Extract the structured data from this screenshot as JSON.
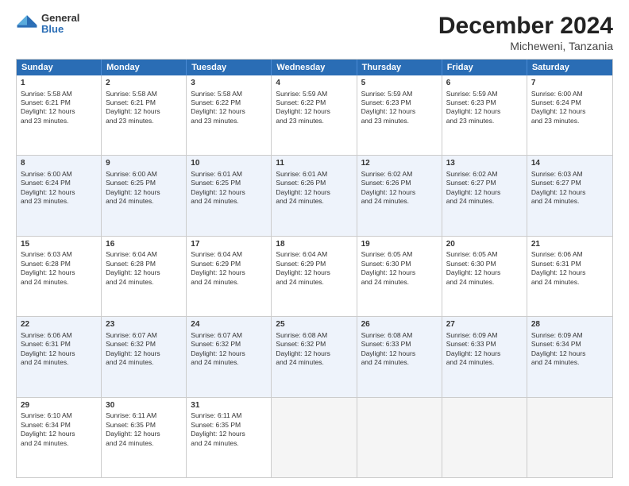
{
  "header": {
    "logo_general": "General",
    "logo_blue": "Blue",
    "month_year": "December 2024",
    "location": "Micheweni, Tanzania"
  },
  "days_of_week": [
    "Sunday",
    "Monday",
    "Tuesday",
    "Wednesday",
    "Thursday",
    "Friday",
    "Saturday"
  ],
  "weeks": [
    [
      {
        "day": "1",
        "lines": [
          "Sunrise: 5:58 AM",
          "Sunset: 6:21 PM",
          "Daylight: 12 hours",
          "and 23 minutes."
        ]
      },
      {
        "day": "2",
        "lines": [
          "Sunrise: 5:58 AM",
          "Sunset: 6:21 PM",
          "Daylight: 12 hours",
          "and 23 minutes."
        ]
      },
      {
        "day": "3",
        "lines": [
          "Sunrise: 5:58 AM",
          "Sunset: 6:22 PM",
          "Daylight: 12 hours",
          "and 23 minutes."
        ]
      },
      {
        "day": "4",
        "lines": [
          "Sunrise: 5:59 AM",
          "Sunset: 6:22 PM",
          "Daylight: 12 hours",
          "and 23 minutes."
        ]
      },
      {
        "day": "5",
        "lines": [
          "Sunrise: 5:59 AM",
          "Sunset: 6:23 PM",
          "Daylight: 12 hours",
          "and 23 minutes."
        ]
      },
      {
        "day": "6",
        "lines": [
          "Sunrise: 5:59 AM",
          "Sunset: 6:23 PM",
          "Daylight: 12 hours",
          "and 23 minutes."
        ]
      },
      {
        "day": "7",
        "lines": [
          "Sunrise: 6:00 AM",
          "Sunset: 6:24 PM",
          "Daylight: 12 hours",
          "and 23 minutes."
        ]
      }
    ],
    [
      {
        "day": "8",
        "lines": [
          "Sunrise: 6:00 AM",
          "Sunset: 6:24 PM",
          "Daylight: 12 hours",
          "and 23 minutes."
        ]
      },
      {
        "day": "9",
        "lines": [
          "Sunrise: 6:00 AM",
          "Sunset: 6:25 PM",
          "Daylight: 12 hours",
          "and 24 minutes."
        ]
      },
      {
        "day": "10",
        "lines": [
          "Sunrise: 6:01 AM",
          "Sunset: 6:25 PM",
          "Daylight: 12 hours",
          "and 24 minutes."
        ]
      },
      {
        "day": "11",
        "lines": [
          "Sunrise: 6:01 AM",
          "Sunset: 6:26 PM",
          "Daylight: 12 hours",
          "and 24 minutes."
        ]
      },
      {
        "day": "12",
        "lines": [
          "Sunrise: 6:02 AM",
          "Sunset: 6:26 PM",
          "Daylight: 12 hours",
          "and 24 minutes."
        ]
      },
      {
        "day": "13",
        "lines": [
          "Sunrise: 6:02 AM",
          "Sunset: 6:27 PM",
          "Daylight: 12 hours",
          "and 24 minutes."
        ]
      },
      {
        "day": "14",
        "lines": [
          "Sunrise: 6:03 AM",
          "Sunset: 6:27 PM",
          "Daylight: 12 hours",
          "and 24 minutes."
        ]
      }
    ],
    [
      {
        "day": "15",
        "lines": [
          "Sunrise: 6:03 AM",
          "Sunset: 6:28 PM",
          "Daylight: 12 hours",
          "and 24 minutes."
        ]
      },
      {
        "day": "16",
        "lines": [
          "Sunrise: 6:04 AM",
          "Sunset: 6:28 PM",
          "Daylight: 12 hours",
          "and 24 minutes."
        ]
      },
      {
        "day": "17",
        "lines": [
          "Sunrise: 6:04 AM",
          "Sunset: 6:29 PM",
          "Daylight: 12 hours",
          "and 24 minutes."
        ]
      },
      {
        "day": "18",
        "lines": [
          "Sunrise: 6:04 AM",
          "Sunset: 6:29 PM",
          "Daylight: 12 hours",
          "and 24 minutes."
        ]
      },
      {
        "day": "19",
        "lines": [
          "Sunrise: 6:05 AM",
          "Sunset: 6:30 PM",
          "Daylight: 12 hours",
          "and 24 minutes."
        ]
      },
      {
        "day": "20",
        "lines": [
          "Sunrise: 6:05 AM",
          "Sunset: 6:30 PM",
          "Daylight: 12 hours",
          "and 24 minutes."
        ]
      },
      {
        "day": "21",
        "lines": [
          "Sunrise: 6:06 AM",
          "Sunset: 6:31 PM",
          "Daylight: 12 hours",
          "and 24 minutes."
        ]
      }
    ],
    [
      {
        "day": "22",
        "lines": [
          "Sunrise: 6:06 AM",
          "Sunset: 6:31 PM",
          "Daylight: 12 hours",
          "and 24 minutes."
        ]
      },
      {
        "day": "23",
        "lines": [
          "Sunrise: 6:07 AM",
          "Sunset: 6:32 PM",
          "Daylight: 12 hours",
          "and 24 minutes."
        ]
      },
      {
        "day": "24",
        "lines": [
          "Sunrise: 6:07 AM",
          "Sunset: 6:32 PM",
          "Daylight: 12 hours",
          "and 24 minutes."
        ]
      },
      {
        "day": "25",
        "lines": [
          "Sunrise: 6:08 AM",
          "Sunset: 6:32 PM",
          "Daylight: 12 hours",
          "and 24 minutes."
        ]
      },
      {
        "day": "26",
        "lines": [
          "Sunrise: 6:08 AM",
          "Sunset: 6:33 PM",
          "Daylight: 12 hours",
          "and 24 minutes."
        ]
      },
      {
        "day": "27",
        "lines": [
          "Sunrise: 6:09 AM",
          "Sunset: 6:33 PM",
          "Daylight: 12 hours",
          "and 24 minutes."
        ]
      },
      {
        "day": "28",
        "lines": [
          "Sunrise: 6:09 AM",
          "Sunset: 6:34 PM",
          "Daylight: 12 hours",
          "and 24 minutes."
        ]
      }
    ],
    [
      {
        "day": "29",
        "lines": [
          "Sunrise: 6:10 AM",
          "Sunset: 6:34 PM",
          "Daylight: 12 hours",
          "and 24 minutes."
        ]
      },
      {
        "day": "30",
        "lines": [
          "Sunrise: 6:11 AM",
          "Sunset: 6:35 PM",
          "Daylight: 12 hours",
          "and 24 minutes."
        ]
      },
      {
        "day": "31",
        "lines": [
          "Sunrise: 6:11 AM",
          "Sunset: 6:35 PM",
          "Daylight: 12 hours",
          "and 24 minutes."
        ]
      },
      null,
      null,
      null,
      null
    ]
  ]
}
